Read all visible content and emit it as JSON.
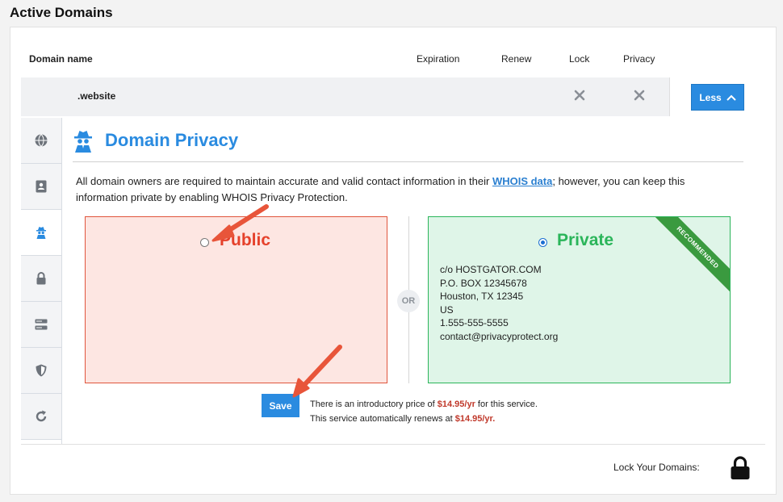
{
  "page_title": "Active Domains",
  "table": {
    "headers": {
      "domain_name": "Domain name",
      "expiration": "Expiration",
      "renew": "Renew",
      "lock": "Lock",
      "privacy": "Privacy"
    },
    "row": {
      "domain": ".website",
      "lock_icon": "x-icon",
      "privacy_icon": "x-icon"
    },
    "less_button": "Less"
  },
  "side_tabs": [
    "globe-icon",
    "contact-card-icon",
    "spy-icon",
    "lock-icon",
    "server-icon",
    "shield-icon",
    "refresh-icon"
  ],
  "panel": {
    "title": "Domain Privacy",
    "desc_before": "All domain owners are required to maintain accurate and valid contact information in their ",
    "desc_link": "WHOIS data",
    "desc_after": "; however, you can keep this information private by enabling WHOIS Privacy Protection.",
    "public": {
      "label": "Public",
      "selected": false
    },
    "or_label": "OR",
    "private": {
      "label": "Private",
      "selected": true,
      "ribbon": "RECOMMENDED",
      "contact_lines": [
        "c/o HOSTGATOR.COM",
        "P.O. BOX 12345678",
        "Houston, TX 12345",
        "US",
        "1.555-555-5555",
        "contact@privacyprotect.org"
      ]
    },
    "save_button": "Save",
    "price_line1_before": "There is an introductory price of ",
    "price_line1_value": "$14.95/yr",
    "price_line1_after": " for this service.",
    "price_line2_before": "This service automatically renews at ",
    "price_line2_value": "$14.95/yr."
  },
  "footer": {
    "lock_label": "Lock Your Domains:"
  },
  "colors": {
    "accent": "#2a8be0",
    "public": "#e5412b",
    "private": "#2bb55a",
    "price": "#c0392b",
    "arrow": "#e8553a"
  }
}
